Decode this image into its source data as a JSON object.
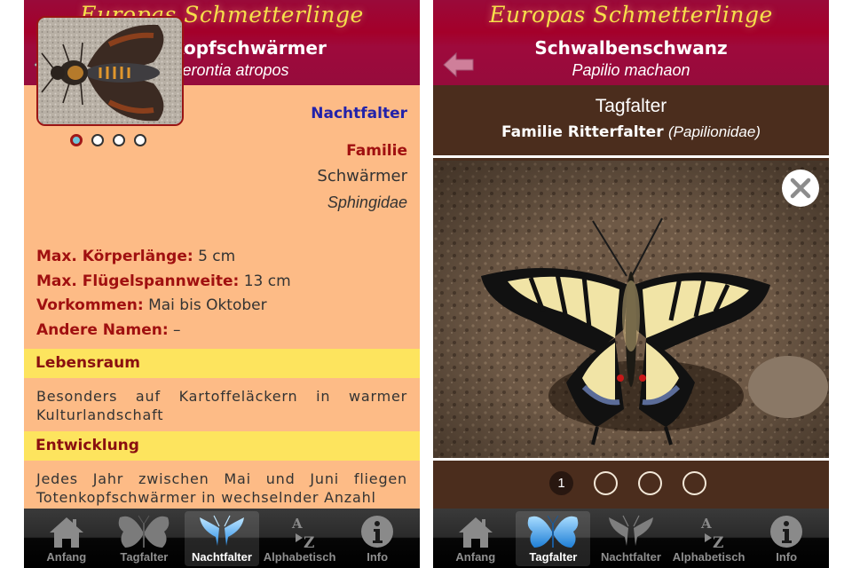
{
  "left_screen": {
    "header": {
      "app_title": "Europas Schmetterlinge",
      "species_name": "Totenkopfschwärmer",
      "species_latin": "Acherontia atropos",
      "back_icon": "back-arrow-icon"
    },
    "image_pager": {
      "count": 4,
      "active_index": 0
    },
    "category": "Nachtfalter",
    "familie": {
      "label": "Familie",
      "name_de": "Schwärmer",
      "name_latin": "Sphingidae"
    },
    "facts": [
      {
        "key": "Max. Körperlänge:",
        "value": "5 cm"
      },
      {
        "key": "Max. Flügelspannweite:",
        "value": "13 cm"
      },
      {
        "key": "Vorkommen:",
        "value": "Mai bis Oktober"
      },
      {
        "key": "Andere Namen:",
        "value": "–"
      }
    ],
    "sections": [
      {
        "title": "Lebensraum",
        "text": "Besonders auf Kartoffeläckern in warmer Kulturlandschaft"
      },
      {
        "title": "Entwicklung",
        "text": "Jedes Jahr zwischen Mai und Juni fliegen Totenkopfschwärmer in wechselnder Anzahl"
      }
    ],
    "tabbar": {
      "active": "Nachtfalter",
      "tabs": [
        {
          "label": "Anfang",
          "icon": "home-icon"
        },
        {
          "label": "Tagfalter",
          "icon": "butterfly-icon"
        },
        {
          "label": "Nachtfalter",
          "icon": "moth-icon"
        },
        {
          "label": "Alphabetisch",
          "icon": "a-to-z-icon"
        },
        {
          "label": "Info",
          "icon": "info-icon"
        }
      ]
    }
  },
  "right_screen": {
    "header": {
      "app_title": "Europas Schmetterlinge",
      "species_name": "Schwalbenschwanz",
      "species_latin": "Papilio machaon",
      "back_icon": "back-arrow-icon"
    },
    "category": "Tagfalter",
    "familie": {
      "prefix": "Familie Ritterfalter",
      "latin": "(Papilionidae)"
    },
    "close_icon": "close-icon",
    "image_pager": {
      "labels": [
        "1",
        "",
        "",
        ""
      ],
      "active_index": 0
    },
    "tabbar": {
      "active": "Tagfalter",
      "tabs": [
        {
          "label": "Anfang",
          "icon": "home-icon"
        },
        {
          "label": "Tagfalter",
          "icon": "butterfly-icon"
        },
        {
          "label": "Nachtfalter",
          "icon": "moth-icon"
        },
        {
          "label": "Alphabetisch",
          "icon": "a-to-z-icon"
        },
        {
          "label": "Info",
          "icon": "info-icon"
        }
      ]
    }
  },
  "colors": {
    "header_red": "#a4002a",
    "title_yellow": "#f6e04a",
    "content_peach": "#fdbb86",
    "section_yellow": "#fde45e",
    "key_red": "#a01010",
    "category_blue": "#2222aa",
    "banner_brown": "#4b2d1d"
  }
}
